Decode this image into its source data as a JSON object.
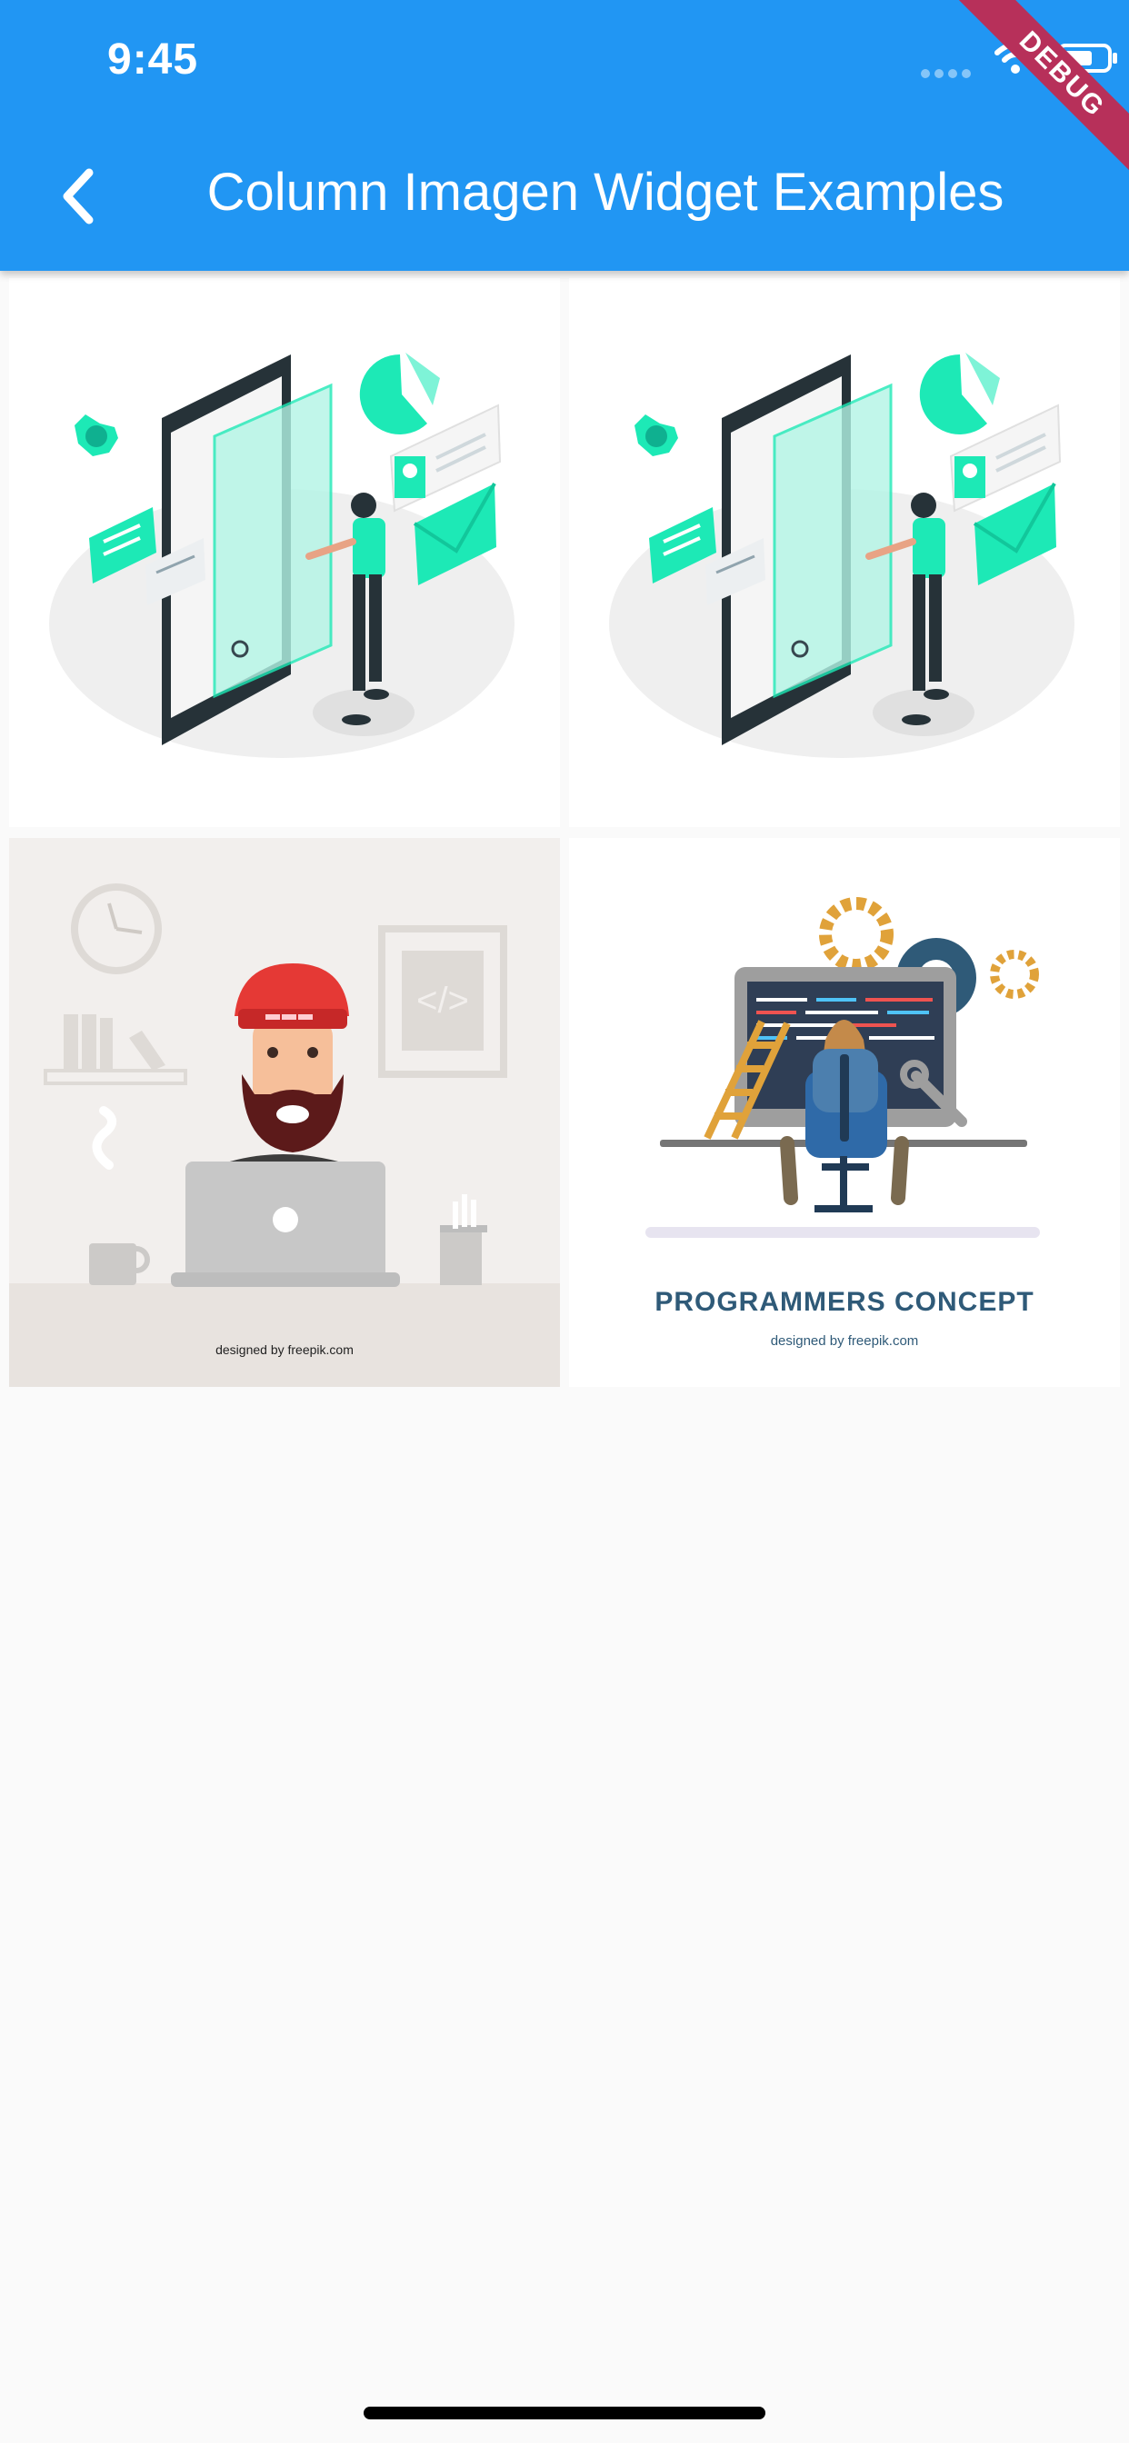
{
  "status_bar": {
    "time": "9:45",
    "icons": [
      "signal-icon",
      "wifi-icon",
      "battery-icon"
    ]
  },
  "app_bar": {
    "title": "Column Imagen Widget Examples",
    "back_icon": "chevron-left-icon",
    "color": "#2196f3"
  },
  "debug_banner": {
    "label": "DEBUG",
    "color": "#b7305a"
  },
  "images": [
    {
      "name": "isometric-phone-illustration"
    },
    {
      "name": "isometric-phone-illustration"
    },
    {
      "name": "bearded-developer-illustration",
      "credit": "designed by  freepik.com"
    },
    {
      "name": "programmers-concept-illustration",
      "caption": "PROGRAMMERS CONCEPT",
      "credit": "designed by  freepik.com"
    }
  ],
  "colors": {
    "accent": "#1de9b6",
    "dark": "#37474f",
    "orange": "#e0a23a",
    "navy": "#2f5a78"
  }
}
